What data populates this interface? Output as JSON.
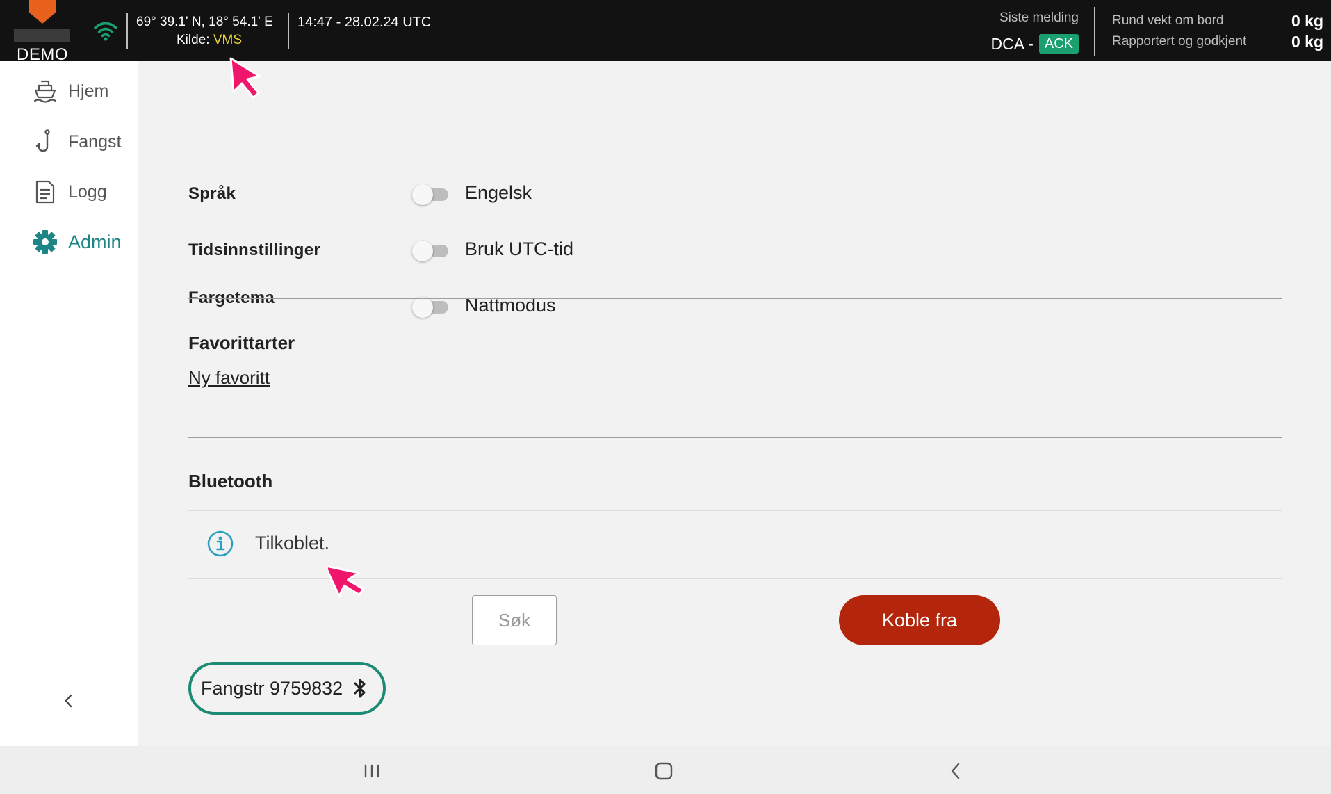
{
  "topbar": {
    "brand_label": "DEMO",
    "coordinates": "69° 39.1' N, 18° 54.1' E",
    "source_prefix": "Kilde:",
    "source_value": "VMS",
    "datetime": "14:47 - 28.02.24 UTC",
    "last_message_label": "Siste melding",
    "last_message_type": "DCA -",
    "last_message_status": "ACK",
    "round_weight_label": "Rund vekt om bord",
    "round_weight_value": "0 kg",
    "reported_label": "Rapportert og godkjent",
    "reported_value": "0 kg",
    "colors": {
      "source": "#e8d43a",
      "ack": "#1aa06f",
      "brand": "#e8621e"
    }
  },
  "sidebar": {
    "items": [
      {
        "label": "Hjem",
        "icon": "boat-icon",
        "active": false
      },
      {
        "label": "Fangst",
        "icon": "fishhook-icon",
        "active": false
      },
      {
        "label": "Logg",
        "icon": "document-icon",
        "active": false
      },
      {
        "label": "Admin",
        "icon": "gear-icon",
        "active": true
      }
    ],
    "accent_color": "#1d8585"
  },
  "settings": {
    "language": {
      "label": "Språk",
      "option": "Engelsk",
      "enabled": false
    },
    "time": {
      "label": "Tidsinnstillinger",
      "option": "Bruk UTC-tid",
      "enabled": false
    },
    "theme": {
      "label": "Fargetema",
      "option": "Nattmodus",
      "enabled": false
    }
  },
  "favorites": {
    "title": "Favorittarter",
    "new_link": "Ny favoritt"
  },
  "bluetooth": {
    "title": "Bluetooth",
    "status": "Tilkoblet.",
    "search_button": "Søk",
    "disconnect_button": "Koble fra",
    "device_name": "Fangstr 9759832",
    "colors": {
      "disconnect": "#b3260c",
      "device_border": "#1d8a73",
      "info": "#2a9fbf"
    }
  },
  "navbar": {
    "buttons": [
      "recent-apps",
      "home",
      "back"
    ]
  }
}
